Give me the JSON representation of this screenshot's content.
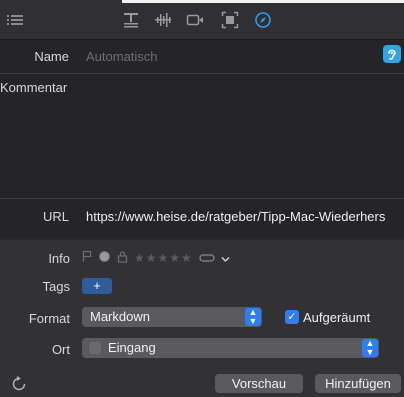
{
  "toolbar": {
    "icons": [
      "list-icon",
      "text-format-icon",
      "waveform-icon",
      "video-icon",
      "screenshot-icon",
      "safari-compass-icon"
    ]
  },
  "fields": {
    "name_label": "Name",
    "name_placeholder": "Automatisch",
    "comment_label": "Kommentar",
    "url_label": "URL",
    "url_value": "https://www.heise.de/ratgeber/Tipp-Mac-Wiederhers"
  },
  "meta": {
    "info_label": "Info",
    "tags_label": "Tags",
    "tags_add": "+",
    "format_label": "Format",
    "format_value": "Markdown",
    "cleanup_label": "Aufgeräumt",
    "cleanup_checked": true,
    "location_label": "Ort",
    "location_value": "Eingang"
  },
  "actions": {
    "preview": "Vorschau",
    "add": "Hinzufügen"
  },
  "colors": {
    "accent": "#2e7cf6",
    "tag": "#2f5d9a",
    "badge": "#2fa4e7"
  }
}
